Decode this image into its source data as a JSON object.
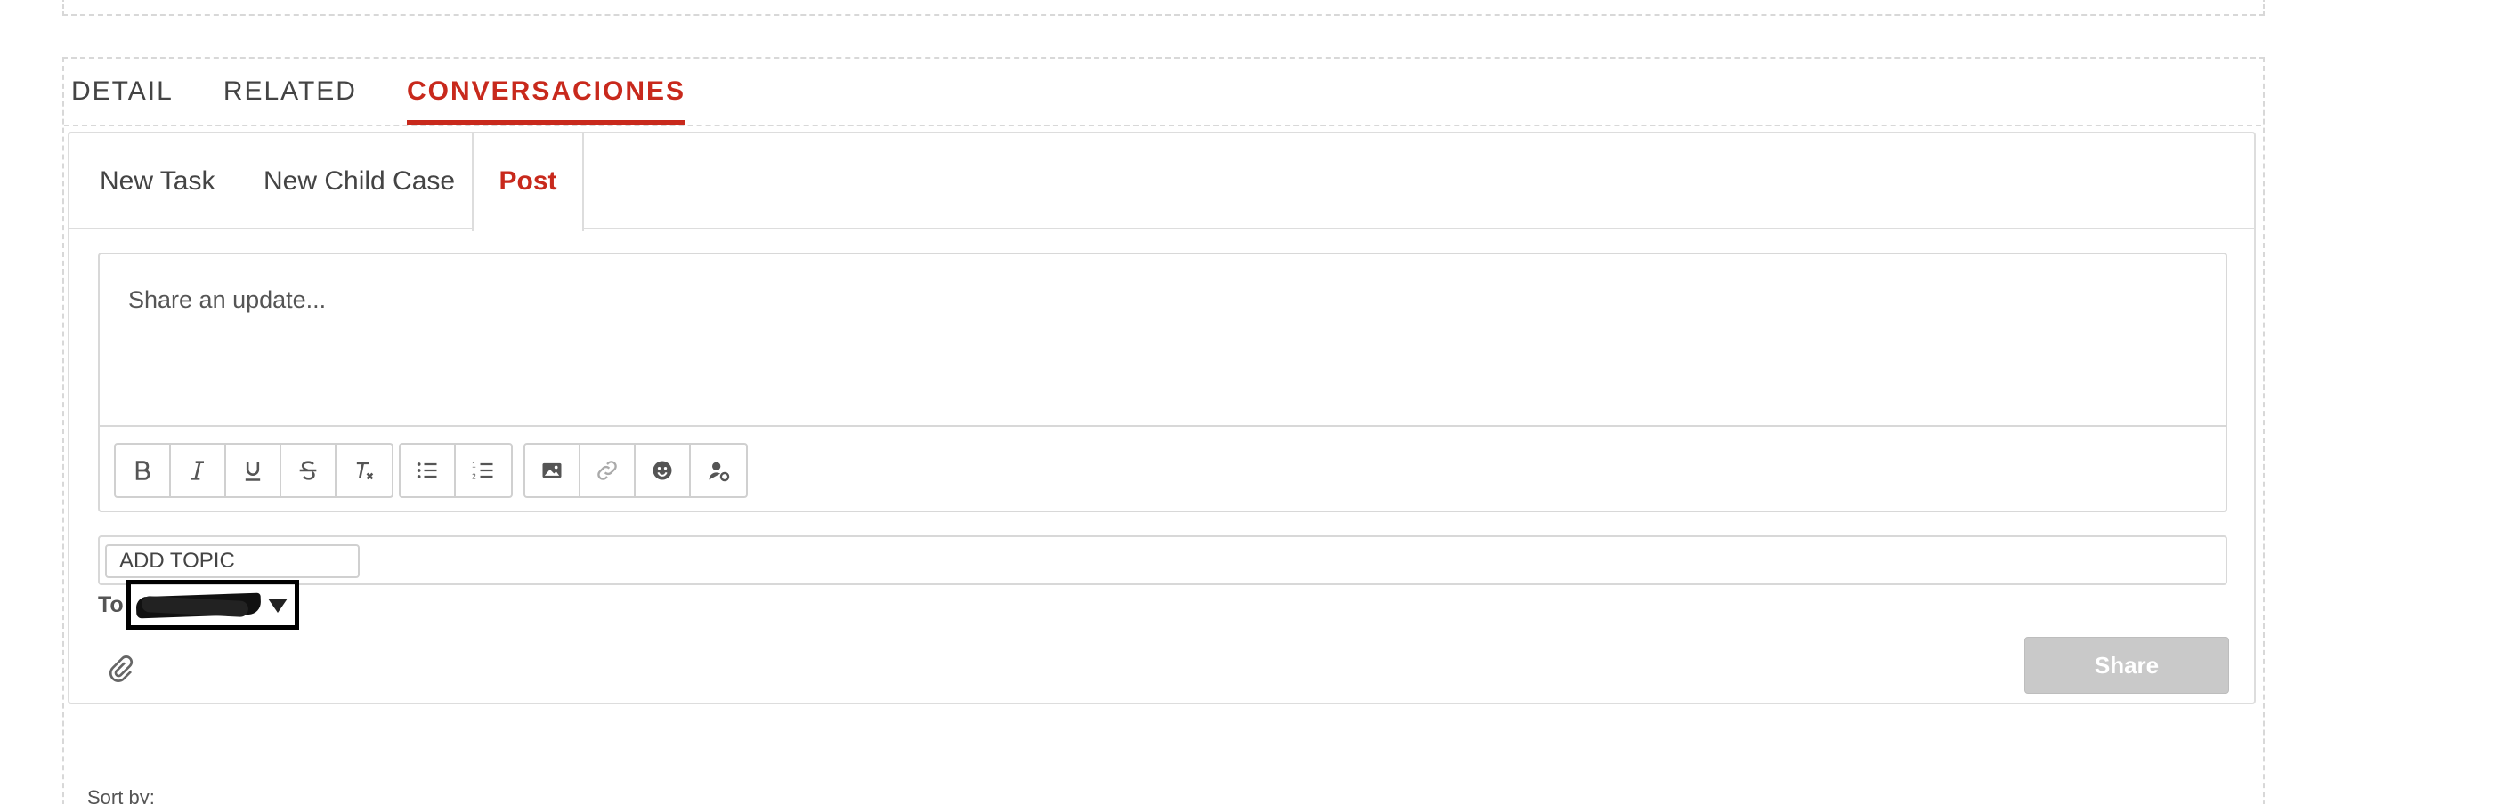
{
  "tabs": [
    {
      "label": "DETAIL",
      "active": false
    },
    {
      "label": "RELATED",
      "active": false
    },
    {
      "label": "CONVERSACIONES",
      "active": true
    }
  ],
  "publisher": {
    "subtabs": [
      {
        "label": "New Task",
        "active": false
      },
      {
        "label": "New Child Case",
        "active": false
      },
      {
        "label": "Post",
        "active": true
      }
    ],
    "editor_placeholder": "Share an update...",
    "toolbar": {
      "group1": [
        "bold-icon",
        "italic-icon",
        "underline-icon",
        "strikethrough-icon",
        "clear-format-icon"
      ],
      "group2": [
        "bulleted-list-icon",
        "numbered-list-icon"
      ],
      "group3": [
        "image-icon",
        "link-icon",
        "emoji-icon",
        "mention-user-icon"
      ]
    },
    "topic_placeholder": "ADD TOPIC",
    "to_label": "To",
    "share_label": "Share"
  },
  "sort_label": "Sort by:",
  "colors": {
    "accent": "#c8291c",
    "border": "#dddddd",
    "share_disabled": "#c9c9c9"
  }
}
